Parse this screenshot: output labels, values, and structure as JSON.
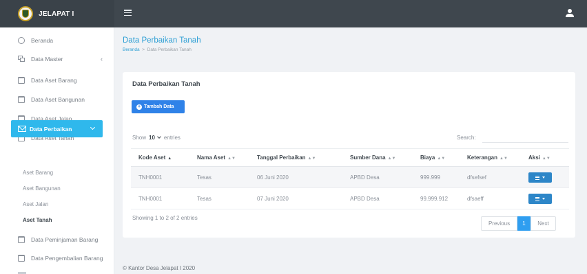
{
  "app": {
    "brand": "JELAPAT I"
  },
  "sidebar": {
    "items": [
      {
        "label": "Beranda",
        "icon": "home-icon"
      },
      {
        "label": "Data Master",
        "icon": "copy-icon"
      },
      {
        "label": "Data Aset Barang",
        "icon": "calendar-icon"
      },
      {
        "label": "Data Aset Bangunan",
        "icon": "calendar-icon"
      },
      {
        "label": "Data Aset Jalan",
        "icon": "calendar-icon"
      },
      {
        "label": "Data Aset Tanah",
        "icon": "calendar-icon"
      },
      {
        "label": "Data Perbaikan",
        "icon": "mail-icon"
      },
      {
        "label": "Data Peminjaman Barang",
        "icon": "calendar-icon"
      },
      {
        "label": "Data Pengembalian Barang",
        "icon": "calendar-icon"
      }
    ],
    "submenu": [
      "Aset Barang",
      "Aset Bangunan",
      "Aset Jalan",
      "Aset Tanah"
    ]
  },
  "page": {
    "title": "Data Perbaikan Tanah",
    "breadcrumb": {
      "home": "Beranda",
      "separator": ">",
      "current": "Data Perbaikan Tanah"
    }
  },
  "card": {
    "title": "Data Perbaikan Tanah",
    "add_button": "Tambah Data",
    "show_label": "Show",
    "page_length": "10",
    "entries_label": "entries",
    "search_label": "Search:"
  },
  "table": {
    "columns": [
      "Kode Aset",
      "Nama Aset",
      "Tanggal Perbaikan",
      "Sumber Dana",
      "Biaya",
      "Keterangan",
      "Aksi"
    ],
    "rows": [
      {
        "kode": "TNH0001",
        "nama": "Tesas",
        "tanggal": "06 Juni 2020",
        "sumber": "APBD Desa",
        "biaya": "999.999",
        "keterangan": "dfsefsef"
      },
      {
        "kode": "TNH0001",
        "nama": "Tesas",
        "tanggal": "07 Juni 2020",
        "sumber": "APBD Desa",
        "biaya": "99.999.912",
        "keterangan": "dfsaeff"
      }
    ]
  },
  "pagination": {
    "info": "Showing 1 to 2 of 2 entries",
    "previous": "Previous",
    "current_page": "1",
    "next": "Next"
  },
  "footer": {
    "text": "© Kantor Desa Jelapat I 2020"
  },
  "colors": {
    "topbar": "#3f474e",
    "accent": "#2fb8ec",
    "primary_button": "#2f82e8",
    "title_link": "#2e9fd4",
    "action_button": "#2d86c8"
  }
}
